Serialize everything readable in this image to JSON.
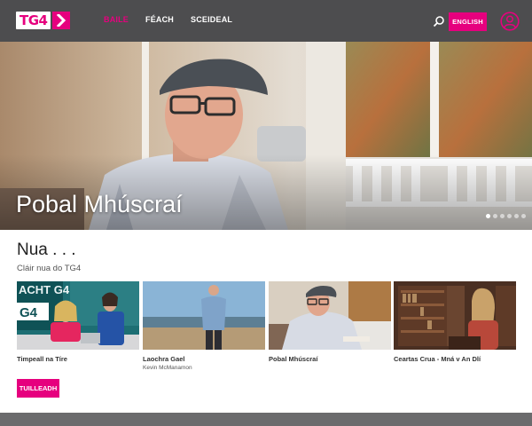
{
  "header": {
    "logo_text": "TG4",
    "nav": [
      {
        "label": "BAILE",
        "active": true
      },
      {
        "label": "FÉACH",
        "active": false
      },
      {
        "label": "SCEIDEAL",
        "active": false
      }
    ],
    "language_button": "ENGLISH",
    "icons": [
      "search-icon",
      "user-account-icon"
    ]
  },
  "hero": {
    "title": "Pobal Mhúscraí",
    "slide_count": 6,
    "active_slide": 1
  },
  "section": {
    "title": "Nua . . .",
    "subtitle": "Cláir nua do TG4"
  },
  "cards": [
    {
      "title": "Timpeall na Tíre",
      "subtitle": "",
      "thumb_text": "ACHT G4"
    },
    {
      "title": "Laochra Gael",
      "subtitle": "Kevin McManamon"
    },
    {
      "title": "Pobal Mhúscraí",
      "subtitle": ""
    },
    {
      "title": "Ceartas Crua - Mná v An Dlí",
      "subtitle": ""
    }
  ],
  "more_button": "TUILLEADH",
  "colors": {
    "brand": "#e6007e",
    "topbar": "#4d4d4f",
    "footer": "#6b6b6d"
  }
}
